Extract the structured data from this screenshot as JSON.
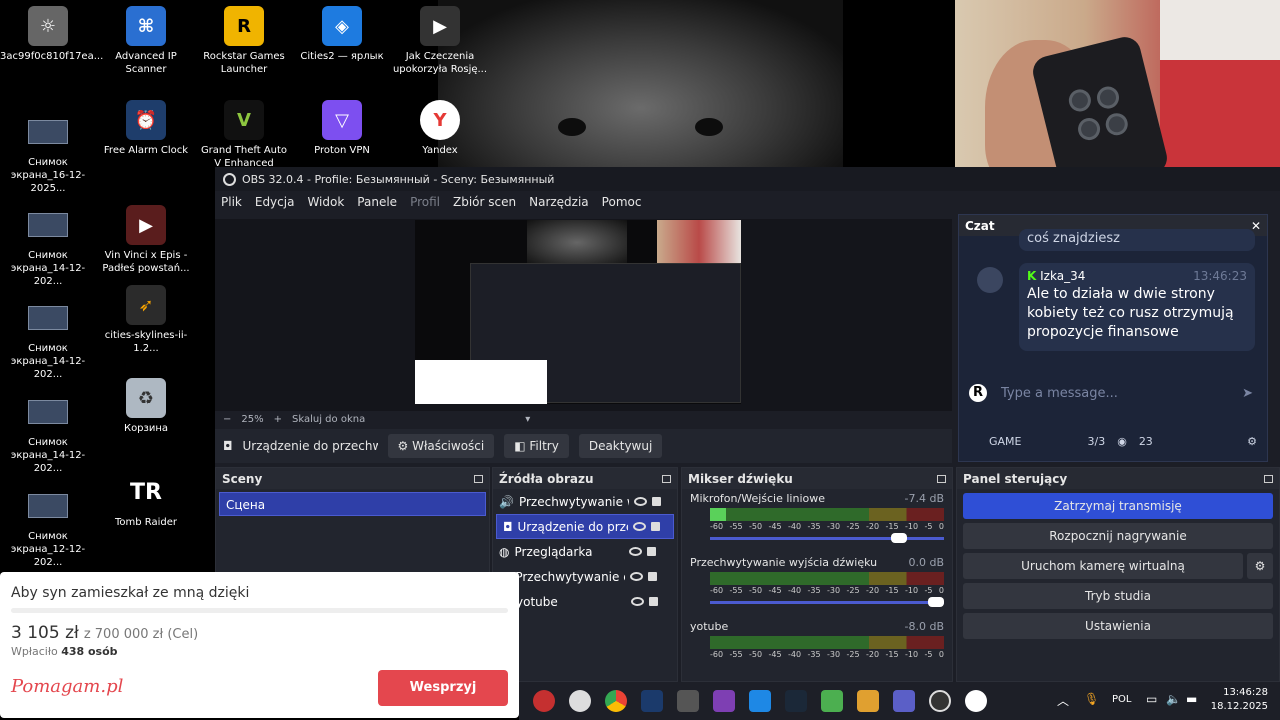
{
  "desktop": {
    "icons": [
      {
        "label": "3ac99f0c810f17ea..."
      },
      {
        "label": "Advanced IP Scanner"
      },
      {
        "label": "Rockstar Games Launcher"
      },
      {
        "label": "Cities2 — ярлык"
      },
      {
        "label": "Jak Czeczenia upokorzyła Rosję..."
      },
      {
        "label": "Снимок экрана_16-12-2025..."
      },
      {
        "label": "Free Alarm Clock"
      },
      {
        "label": "Grand Theft Auto V Enhanced"
      },
      {
        "label": "Proton VPN"
      },
      {
        "label": "Yandex"
      },
      {
        "label": "Снимок экрана_14-12-202..."
      },
      {
        "label": "Vin Vinci x Epis - Padłeś powstań..."
      },
      {
        "label": "Снимок экрана_14-12-202..."
      },
      {
        "label": "cities-skylines-ii-1.2..."
      },
      {
        "label": "Снимок экрана_14-12-202..."
      },
      {
        "label": "Корзина"
      },
      {
        "label": "Снимок экрана_12-12-202..."
      },
      {
        "label": "Tomb Raider"
      }
    ]
  },
  "obs": {
    "title": "OBS 32.0.4 - Profile: Безымянный - Sceny: Безымянный",
    "menu": [
      "Plik",
      "Edycja",
      "Widok",
      "Panele",
      "Profil",
      "Zbiór scen",
      "Narzędzia",
      "Pomoc"
    ],
    "zoom": "25%",
    "scale_label": "Skaluj do okna",
    "source_label": "Urządzenie do przechwyt",
    "btn_properties": "Właściwości",
    "btn_filters": "Filtry",
    "btn_deactivate": "Deaktywuj",
    "scenes_title": "Sceny",
    "scene_item": "Сцена",
    "sources_title": "Źródła obrazu",
    "sources": [
      {
        "name": "Przechwytywanie wyjś"
      },
      {
        "name": "Urządzenie do przech"
      },
      {
        "name": "Przeglądarka"
      },
      {
        "name": "Przechwytywanie ekra"
      },
      {
        "name": "yotube"
      }
    ],
    "mixer_title": "Mikser dźwięku",
    "mixer": [
      {
        "name": "Mikrofon/Wejście liniowe",
        "db": "-7.4 dB",
        "level": 0.07,
        "volume": 0.84
      },
      {
        "name": "Przechwytywanie wyjścia dźwięku",
        "db": "0.0 dB",
        "level": 0,
        "volume": 1.0
      },
      {
        "name": "yotube",
        "db": "-8.0 dB",
        "level": 0,
        "volume": 0.8
      }
    ],
    "ticks": [
      "-60",
      "-55",
      "-50",
      "-45",
      "-40",
      "-35",
      "-30",
      "-25",
      "-20",
      "-15",
      "-10",
      "-5",
      "0"
    ],
    "control_title": "Panel sterujący",
    "controls": [
      "Zatrzymaj transmisję",
      "Rozpocznij nagrywanie",
      "Uruchom kamerę wirtualną",
      "Tryb studia",
      "Ustawienia"
    ]
  },
  "chat": {
    "title": "Czat",
    "prev_fragment": "coś znajdziesz",
    "user": "Izka_34",
    "time": "13:46:23",
    "message": "Ale to działa w dwie strony kobiety też co rusz otrzymują propozycje finansowe",
    "input_placeholder": "Type a message...",
    "channel": "GAME",
    "slots": "3/3",
    "viewers": "23"
  },
  "popup": {
    "title": "Aby syn zamieszkał ze mną dzięki",
    "amount": "3 105 zł",
    "goal": "z 700 000 zł (Cel)",
    "paid_prefix": "Wpłaciło",
    "paid_count": "438 osób",
    "brand": "Pomagam.pl",
    "support_button": "Wesprzyj"
  },
  "taskbar": {
    "lang": "POL",
    "time": "13:46:28",
    "date": "18.12.2025"
  },
  "colors": {
    "accent": "#2f4fd6",
    "obs_bg": "#1c1e26",
    "brand_red": "#e4474e"
  }
}
